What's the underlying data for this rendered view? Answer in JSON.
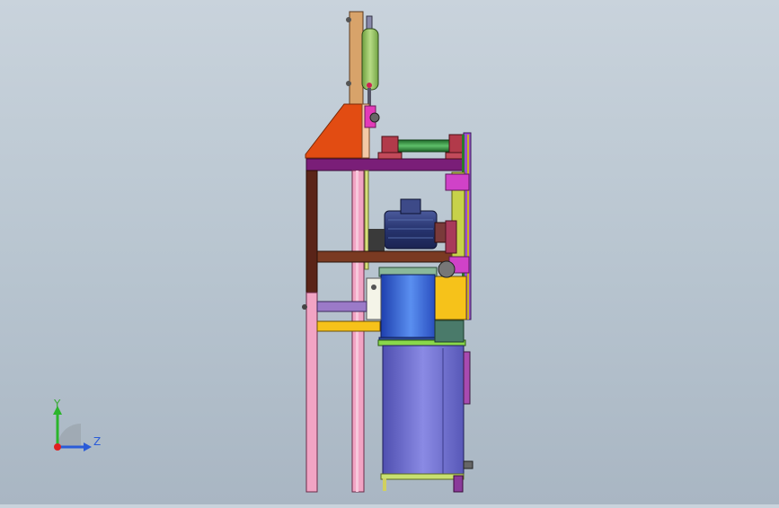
{
  "viewport": {
    "background_top": "#c9d3dc",
    "background_bottom": "#a9b6c3"
  },
  "triad": {
    "y_label": "Y",
    "z_label": "Z",
    "x_color": "#e02020",
    "y_color": "#2bb52b",
    "z_color": "#2a5bd8"
  },
  "colors": {
    "base_frame": "#f2a2c4",
    "top_beam": "#7b1f78",
    "mid_beam": "#7a3a22",
    "gusset": "#e04a10",
    "cylinder": "#8fbf5a",
    "shaft": "#2e8b3a",
    "tank": "#6f6fd0",
    "motor": "#2c3a78",
    "drum": "#3a6fd8",
    "support": "#f6c21a",
    "chain": "#9b4fd0",
    "post": "#e0a46a"
  }
}
